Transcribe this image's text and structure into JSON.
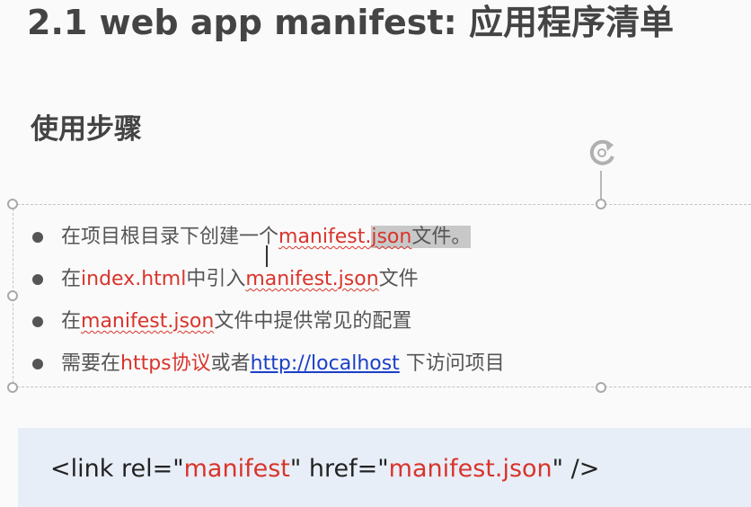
{
  "slide": {
    "title": "2.1 web app manifest: 应用程序清单",
    "subtitle": "使用步骤"
  },
  "steps": [
    {
      "p1": "在项目根目录下创建一个",
      "p2": "manifest.",
      "p3": "json",
      "p4": "文件。"
    },
    {
      "p1": "在",
      "p2": "index.html",
      "p3": "中引入",
      "p4": "manifest.json",
      "p5": "文件"
    },
    {
      "p1": "在",
      "p2": "manifest.json",
      "p3": "文件中提供常见的配置"
    },
    {
      "p1": "需要在",
      "p2": "https协议",
      "p3": "或者",
      "p4": "http://localhost",
      "p5": " 下访问项目"
    }
  ],
  "code": {
    "c1": "<link rel=\"",
    "c2": "manifest",
    "c3": "\" href=\"",
    "c4": "manifest.json",
    "c5": "\" />"
  },
  "colors": {
    "accent_red": "#d9342b",
    "link_blue": "#1a3fc7",
    "code_bg": "#e8eef8"
  }
}
